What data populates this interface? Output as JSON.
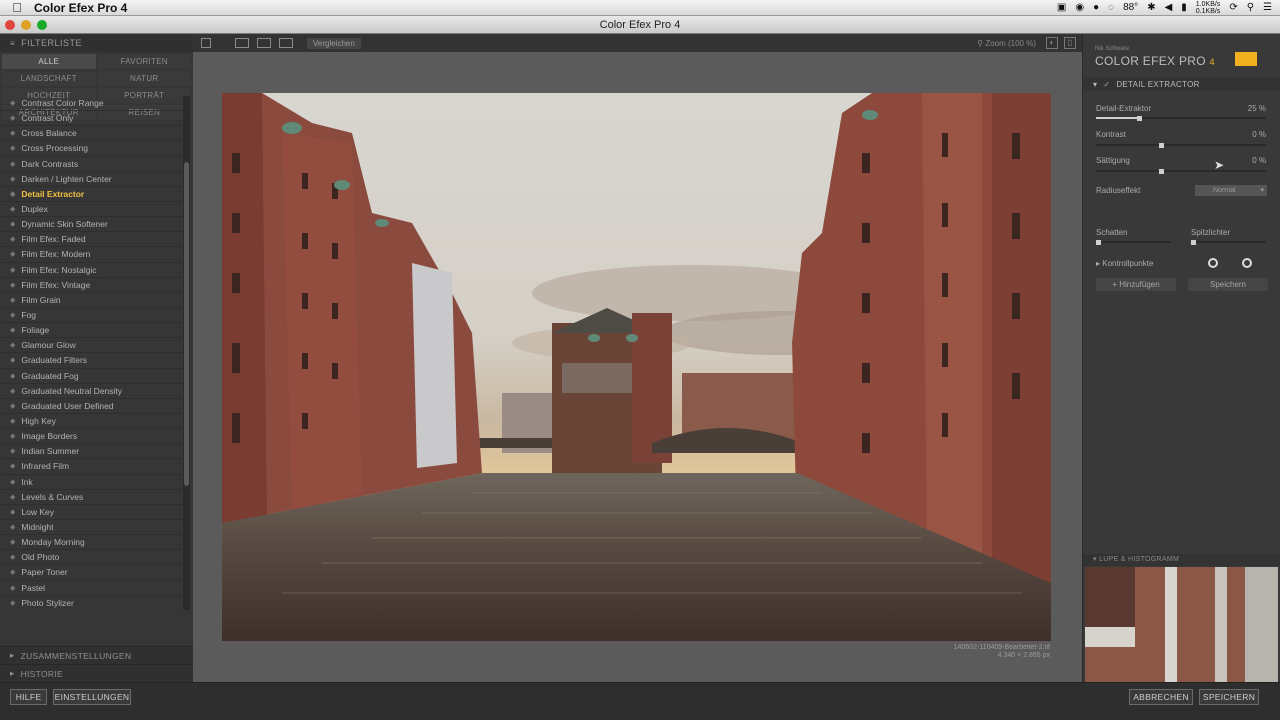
{
  "menubar": {
    "app_name": "Color Efex Pro 4",
    "battery": "88°",
    "net_up": "1.0KB/s",
    "net_down": "0.1KB/s"
  },
  "window": {
    "title": "Color Efex Pro 4"
  },
  "left_panel": {
    "header": "FILTERLISTE",
    "categories": [
      "ALLE",
      "FAVORITEN",
      "LANDSCHAFT",
      "NATUR",
      "HOCHZEIT",
      "PORTRÄT",
      "ARCHITEKTUR",
      "REISEN"
    ],
    "active_category": "ALLE",
    "filters": [
      "Contrast Color Range",
      "Contrast Only",
      "Cross Balance",
      "Cross Processing",
      "Dark Contrasts",
      "Darken / Lighten Center",
      "Detail Extractor",
      "Duplex",
      "Dynamic Skin Softener",
      "Film Efex: Faded",
      "Film Efex: Modern",
      "Film Efex: Nostalgic",
      "Film Efex: Vintage",
      "Film Grain",
      "Fog",
      "Foliage",
      "Glamour Glow",
      "Graduated Filters",
      "Graduated Fog",
      "Graduated Neutral Density",
      "Graduated User Defined",
      "High Key",
      "Image Borders",
      "Indian Summer",
      "Infrared Film",
      "Ink",
      "Levels & Curves",
      "Low Key",
      "Midnight",
      "Monday Morning",
      "Old Photo",
      "Paper Toner",
      "Pastel",
      "Photo Stylizer"
    ],
    "active_filter": "Detail Extractor",
    "footer_1": "ZUSAMMENSTELLUNGEN",
    "footer_2": "HISTORIE"
  },
  "toolbar": {
    "compare_label": "Vergleichen",
    "zoom_label": "Zoom (100 %)"
  },
  "preview": {
    "caption_line1": "140602-110409-Bearbeitet-2.tif",
    "caption_line2": "4.340 × 2.865 px"
  },
  "right_panel": {
    "brand_small": "Nik Software",
    "brand": "COLOR EFEX PRO",
    "brand_version": "4",
    "filter_name": "DETAIL EXTRACTOR",
    "controls": {
      "detail_label": "Detail-Extraktor",
      "detail_value": "25 %",
      "detail_level": 0.25,
      "contrast_label": "Kontrast",
      "contrast_value": "0 %",
      "saturation_label": "Sättigung",
      "saturation_value": "0 %",
      "radius_label": "Radiuseffekt",
      "radius_value": "Normal",
      "shadows_label": "Schatten",
      "highlights_label": "Spitzlichter",
      "control_points_label": "Kontrollpunkte",
      "add_button": "+ Hinzufügen",
      "save_button": "Speichern"
    },
    "loupe_header": "LUPE & HISTOGRAMM"
  },
  "bottom": {
    "help": "HILFE",
    "settings": "EINSTELLUNGEN",
    "cancel": "ABBRECHEN",
    "save": "SPEICHERN"
  }
}
